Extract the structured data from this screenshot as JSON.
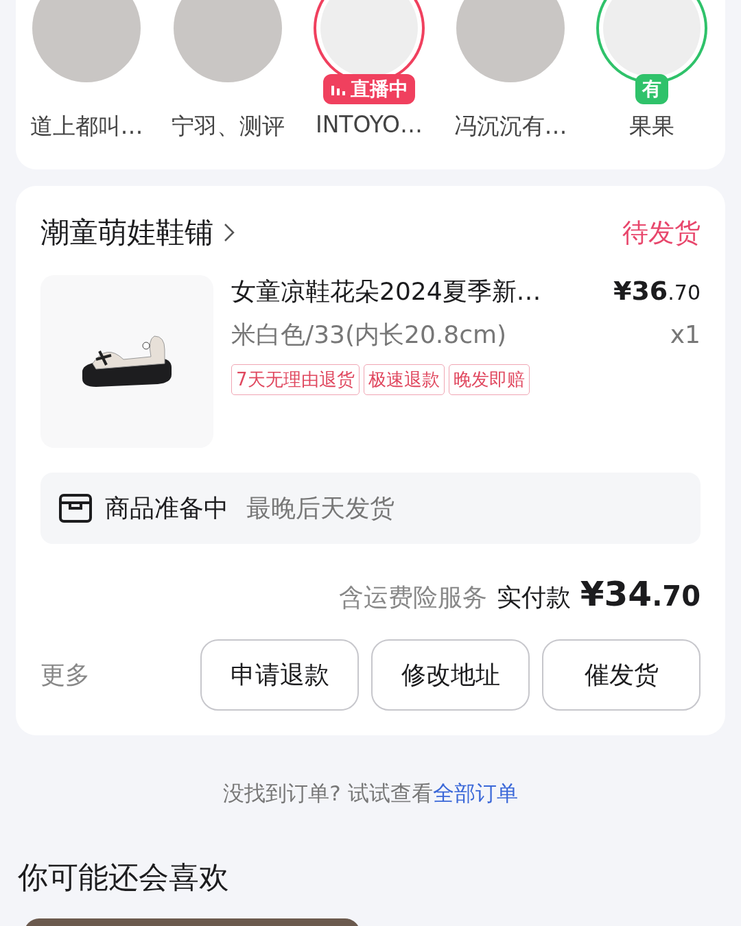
{
  "following": [
    {
      "name": "道上都叫…"
    },
    {
      "name": "宁羽、测评"
    },
    {
      "name": "INTOYO…",
      "badge": {
        "kind": "live",
        "text": "直播中"
      }
    },
    {
      "name": "冯沉沉有…"
    },
    {
      "name": "果果",
      "badge": {
        "kind": "update",
        "text": "有"
      }
    }
  ],
  "order": {
    "shop": "潮童萌娃鞋铺",
    "status": "待发货",
    "item": {
      "title": "女童凉鞋花朵2024夏季新…",
      "price_main": "¥36",
      "price_decimal": ".70",
      "spec": "米白色/33(内长20.8cm)",
      "quantity": "x1",
      "tags": [
        "7天无理由退货",
        "极速退款",
        "晚发即赔"
      ]
    },
    "progress": {
      "label": "商品准备中",
      "note": "最晚后天发货"
    },
    "total": {
      "note": "含运费险服务",
      "label": "实付款",
      "amount_main": "¥34",
      "amount_decimal": ".70"
    },
    "more": "更多",
    "buttons": [
      "申请退款",
      "修改地址",
      "催发货"
    ]
  },
  "hint": {
    "text": "没找到订单? 试试查看",
    "link": "全部订单"
  },
  "recommend": {
    "title": "你可能还会喜欢"
  }
}
